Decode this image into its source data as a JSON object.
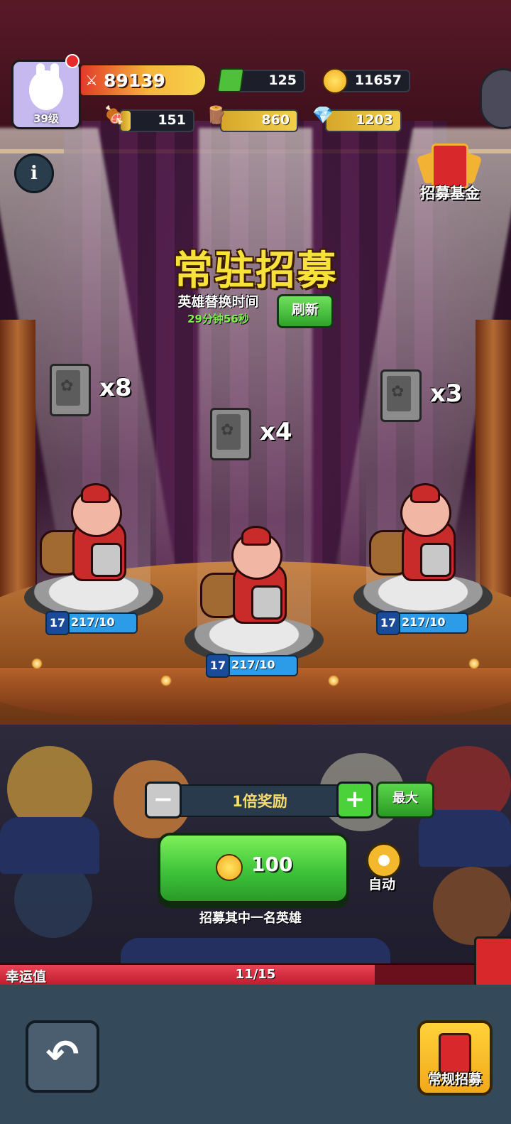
{
  "player": {
    "level": "39级",
    "power": "89139"
  },
  "resources": {
    "gems": "125",
    "gold": "11657",
    "meat": "151",
    "wood": "860",
    "crystal": "1203"
  },
  "fund_label": "招募基金",
  "banner": {
    "title": "常驻招募",
    "swap_label": "英雄替换时间",
    "countdown": "29分钟56秒",
    "refresh_label": "刷新"
  },
  "heroes": [
    {
      "shard_count": "x8",
      "level": "17",
      "progress": "217/10"
    },
    {
      "shard_count": "x4",
      "level": "17",
      "progress": "217/10"
    },
    {
      "shard_count": "x3",
      "level": "17",
      "progress": "217/10"
    }
  ],
  "multiplier": {
    "label": "1倍奖励",
    "max_label": "最大"
  },
  "recruit": {
    "cost": "100",
    "description": "招募其中一名英雄",
    "auto_label": "自动"
  },
  "luck": {
    "label": "幸运值",
    "value": "11/15",
    "fraction": 0.733
  },
  "nav": {
    "normal_recruit_label": "常规招募"
  },
  "icons": {
    "info": "info-icon",
    "back": "back-arrow-icon",
    "gear": "gear-icon",
    "gem": "green-gem-icon",
    "coin": "gold-coin-icon",
    "meat": "meat-icon",
    "wood": "wood-log-icon",
    "crystal": "crystal-icon",
    "sword": "crossed-swords-icon"
  },
  "colors": {
    "title": "#f7e23a",
    "countdown": "#7ef04a",
    "primary_button": "#3ec43a",
    "luck_fill": "#e94456",
    "level_pill": "#2c9be8"
  }
}
